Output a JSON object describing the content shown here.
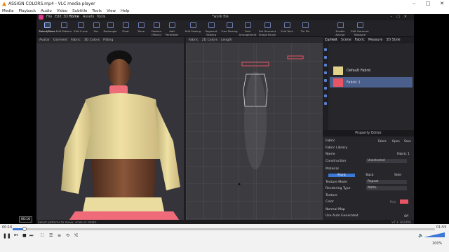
{
  "vlc": {
    "title": "ASSIGN COLORS.mp4 - VLC media player",
    "menu": [
      "Media",
      "Playback",
      "Audio",
      "Video",
      "Subtitle",
      "Tools",
      "View",
      "Help"
    ],
    "elapsed": "00:16",
    "remaining": "01:55",
    "tooltip_time": "00:16",
    "volume": "100%"
  },
  "clo": {
    "menu": [
      "File",
      "Edit",
      "3D"
    ],
    "tabs": [
      "Home",
      "Assets",
      "Tools"
    ],
    "file_name": "*work file",
    "toolbar": [
      "Select/Move",
      "Edit Pattern",
      "Edit Curve",
      "Pen",
      "Rectangle",
      "Pivot",
      "Trace",
      "Fashion (Pencil)",
      "Add Perimeter",
      "Edit Sewing",
      "Segment Sewing",
      "Free Sewing",
      "Fold Arrangement",
      "Set Garment Shape Brush",
      "Fold Tack",
      "Tie Pin",
      "Enable Anchor Measure",
      "Edit Garment Measure"
    ],
    "panel3d": {
      "tabs": [
        "Avatar",
        "Garment",
        "Fabric",
        "3D Colors",
        "Fitting"
      ]
    },
    "panel2d": {
      "tabs": [
        "Fabric",
        "2D Colors",
        "Length"
      ]
    },
    "object_browser": {
      "tabs": [
        "Current",
        "Scene",
        "Fabric",
        "Measure",
        "3D Style"
      ],
      "fabrics": [
        {
          "name": "Default Fabric",
          "color": "#e3d28a"
        },
        {
          "name": "Fabric 1",
          "color": "#e85565"
        }
      ]
    },
    "property_editor": {
      "title": "Property Editor",
      "section": "Fabric",
      "buttons": [
        "Fabric",
        "Open",
        "Save"
      ],
      "rows": [
        {
          "label": "Fabric Library",
          "value": ""
        },
        {
          "label": "Name",
          "value": "Fabric 1"
        },
        {
          "label": "Construction",
          "value": "Unselected"
        },
        {
          "label": "Material",
          "value": ""
        },
        {
          "label": "Texture Mode",
          "value": "Repeat"
        },
        {
          "label": "Rendering Type",
          "value": "Matte"
        },
        {
          "label": "Texture",
          "value": ""
        },
        {
          "label": "Color",
          "value": "Pink"
        },
        {
          "label": "Normal Map",
          "value": ""
        },
        {
          "label": "Use Auto Generated",
          "value": "Off"
        }
      ],
      "material_tabs": [
        "Front",
        "Back",
        "Side"
      ]
    },
    "status": "Select patterns to move, scale or rotate",
    "version": "V7.1.102(R0)"
  }
}
